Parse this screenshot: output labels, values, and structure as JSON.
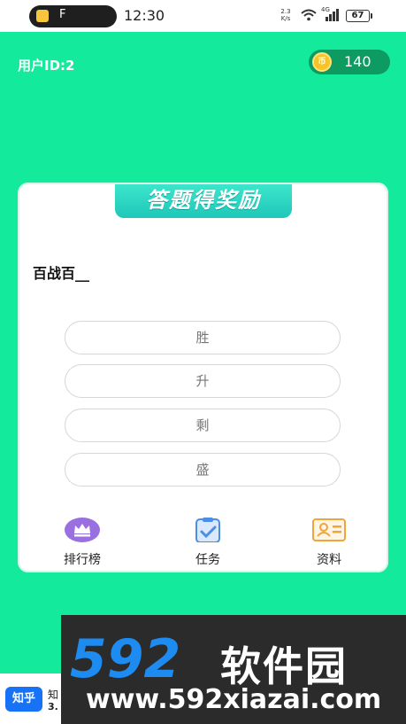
{
  "status_bar": {
    "pill_text": "F",
    "time": "12:30",
    "net_speed_value": "2.3",
    "net_speed_unit": "K/s",
    "signal_tag": "4G",
    "battery": "67"
  },
  "header": {
    "user_id": "用户ID:2",
    "coin_label": "币",
    "coins": "140"
  },
  "card": {
    "title": "答题得奖励",
    "question": "百战百__",
    "options": [
      "胜",
      "升",
      "剩",
      "盛"
    ]
  },
  "nav": {
    "ranking": "排行榜",
    "tasks": "任务",
    "profile": "资料"
  },
  "ad": {
    "logo": "知乎",
    "name": "知",
    "version": "3."
  },
  "watermark": {
    "logo": "592",
    "title": "软件园",
    "url": "www.592xiazai.com"
  },
  "colors": {
    "background": "#14ea9c",
    "coin_chip": "#0e9b61",
    "title_banner": "#1fc7b8",
    "ranking_icon": "#9a6fe0",
    "task_icon": "#4a8ee8",
    "profile_icon": "#f0a53a"
  }
}
